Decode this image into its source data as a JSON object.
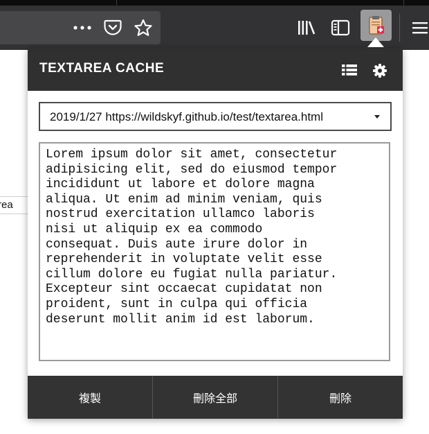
{
  "browser": {
    "icons": [
      "more-icon",
      "pocket-icon",
      "bookmark-star-icon",
      "library-icon",
      "sidebar-icon",
      "extension-clipboard-icon",
      "menu-icon"
    ],
    "page_fragment_text": "rea"
  },
  "popup": {
    "title": "TEXTAREA CACHE",
    "header_icons": [
      "list-icon",
      "settings-gear-icon"
    ],
    "select": {
      "value": "2019/1/27 https://wildskyf.github.io/test/textarea.html"
    },
    "textarea": {
      "value": "Lorem ipsum dolor sit amet, consectetur\nadipisicing elit, sed do eiusmod tempor\nincididunt ut labore et dolore magna\naliqua. Ut enim ad minim veniam, quis\nnostrud exercitation ullamco laboris\nnisi ut aliquip ex ea commodo\nconsequat. Duis aute irure dolor in\nreprehenderit in voluptate velit esse\ncillum dolore eu fugiat nulla pariatur.\nExcepteur sint occaecat cupidatat non\nproident, sunt in culpa qui officia\ndeserunt mollit anim id est laborum."
    },
    "buttons": {
      "copy": "複製",
      "delete_all": "刪除全部",
      "delete": "刪除"
    }
  },
  "colors": {
    "toolbar": "#323234",
    "popup_header": "#303030",
    "footer": "#333333",
    "badge_red": "#e22850"
  }
}
